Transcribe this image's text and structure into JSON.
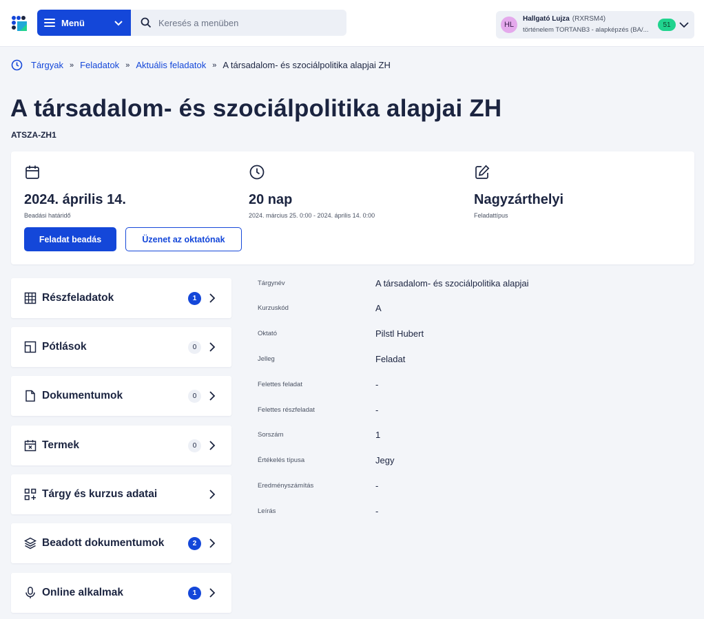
{
  "header": {
    "menu_label": "Menü",
    "search_placeholder": "Keresés a menüben",
    "user": {
      "initials": "HL",
      "name": "Hallgató Lujza",
      "code": "(RXRSM4)",
      "program": "történelem TORTANB3 - alapképzés (BA/...",
      "badge": "51"
    }
  },
  "breadcrumb": {
    "items": [
      "Tárgyak",
      "Feladatok",
      "Aktuális feladatok"
    ],
    "current": "A társadalom- és szociálpolitika alapjai ZH"
  },
  "page": {
    "title": "A társadalom- és szociálpolitika alapjai ZH",
    "code": "ATSZA-ZH1"
  },
  "info": {
    "deadline": {
      "value": "2024. április 14.",
      "label": "Beadási határidő"
    },
    "duration": {
      "value": "20 nap",
      "label": "2024. március 25. 0:00 - 2024. április 14. 0:00"
    },
    "type": {
      "value": "Nagyzárthelyi",
      "label": "Feladattípus"
    },
    "submit_button": "Feladat beadás",
    "message_button": "Üzenet az oktatónak"
  },
  "side_menu": [
    {
      "label": "Részfeladatok",
      "icon": "grid-icon",
      "count": "1",
      "highlight": true
    },
    {
      "label": "Pótlások",
      "icon": "layout-icon",
      "count": "0",
      "highlight": false
    },
    {
      "label": "Dokumentumok",
      "icon": "file-icon",
      "count": "0",
      "highlight": false
    },
    {
      "label": "Termek",
      "icon": "calendar-x-icon",
      "count": "0",
      "highlight": false
    },
    {
      "label": "Tárgy és kurzus adatai",
      "icon": "apps-add-icon",
      "count": "",
      "highlight": false
    },
    {
      "label": "Beadott dokumentumok",
      "icon": "layers-icon",
      "count": "2",
      "highlight": true
    },
    {
      "label": "Online alkalmak",
      "icon": "microphone-icon",
      "count": "1",
      "highlight": true
    }
  ],
  "details": [
    {
      "label": "Tárgynév",
      "value": "A társadalom- és szociálpolitika alapjai"
    },
    {
      "label": "Kurzuskód",
      "value": "A"
    },
    {
      "label": "Oktató",
      "value": "Pilstl Hubert"
    },
    {
      "label": "Jelleg",
      "value": "Feladat"
    },
    {
      "label": "Felettes feladat",
      "value": "-"
    },
    {
      "label": "Felettes részfeladat",
      "value": "-"
    },
    {
      "label": "Sorszám",
      "value": "1"
    },
    {
      "label": "Értékelés típusa",
      "value": "Jegy"
    },
    {
      "label": "Eredményszámítás",
      "value": "-"
    },
    {
      "label": "Leírás",
      "value": "-"
    }
  ],
  "colors": {
    "primary": "#1447d9",
    "text": "#1b2440",
    "background": "#f3f5f9",
    "badge_green": "#20d38e"
  }
}
